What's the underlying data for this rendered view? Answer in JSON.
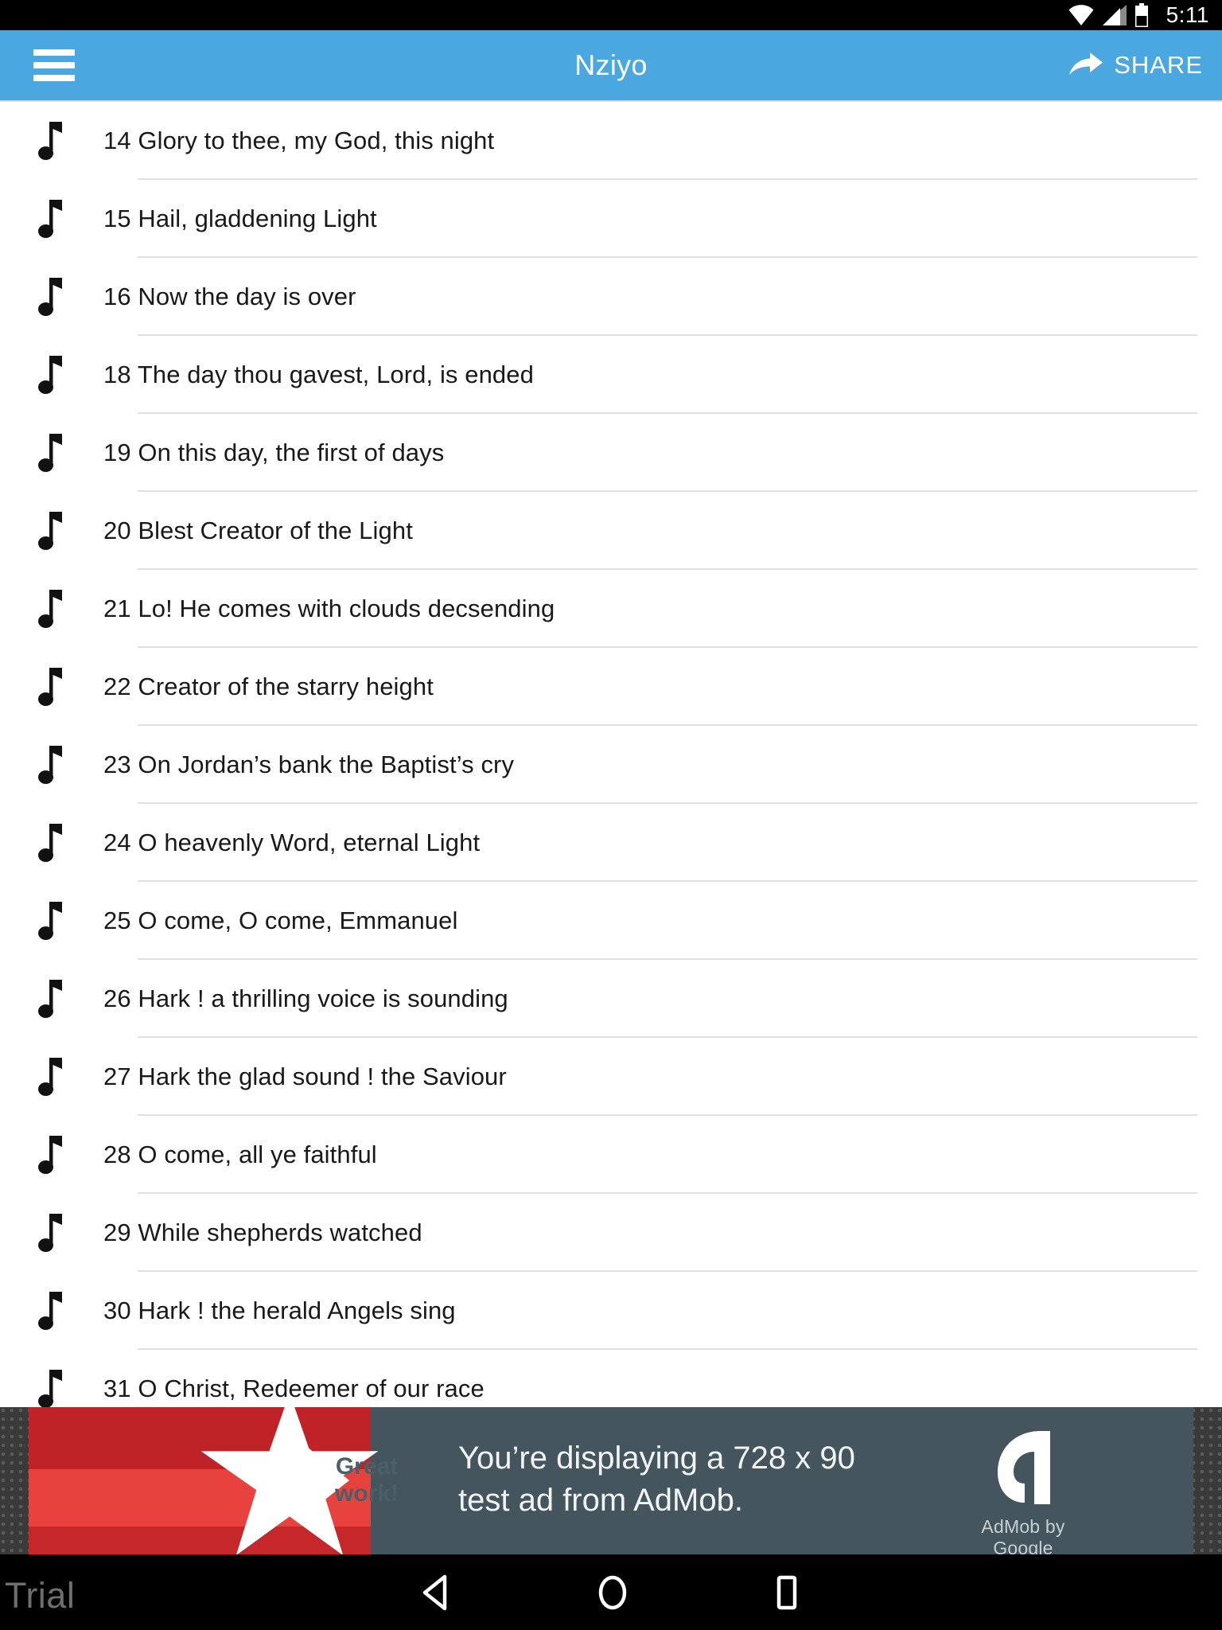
{
  "status_bar": {
    "time": "5:11",
    "icons": [
      "wifi-icon",
      "cell-signal-icon",
      "battery-icon"
    ]
  },
  "app_bar": {
    "menu_icon": "hamburger-menu-icon",
    "title": "Nziyo",
    "share_label": "SHARE",
    "share_icon": "share-arrow-icon",
    "background_color": "#4aa7e0"
  },
  "list": {
    "item_icon": "music-note-icon",
    "items": [
      {
        "label": "14 Glory to thee, my God, this night"
      },
      {
        "label": "15 Hail, gladdening Light"
      },
      {
        "label": "16 Now the day is over"
      },
      {
        "label": "18 The day thou gavest, Lord, is ended"
      },
      {
        "label": "19 On this day, the first of days"
      },
      {
        "label": "20 Blest Creator of the Light"
      },
      {
        "label": "21 Lo! He comes with clouds decsending"
      },
      {
        "label": "22 Creator of the starry height"
      },
      {
        "label": "23 On Jordan’s bank the Baptist’s cry"
      },
      {
        "label": "24 O heavenly Word, eternal Light"
      },
      {
        "label": "25 O come, O come, Emmanuel"
      },
      {
        "label": "26 Hark ! a thrilling voice is sounding"
      },
      {
        "label": "27 Hark the glad sound ! the Saviour"
      },
      {
        "label": "28 O come, all ye faithful"
      },
      {
        "label": "29 While shepherds watched"
      },
      {
        "label": "30 Hark ! the herald Angels sing"
      },
      {
        "label": "31 O Christ, Redeemer of our race"
      }
    ]
  },
  "ad": {
    "badge_line1": "Great",
    "badge_line2": "work!",
    "message_line1": "You’re displaying a 728 x 90",
    "message_line2": "test ad from AdMob.",
    "brand": "AdMob by Google",
    "logo_icon": "admob-logo-icon",
    "red_color": "#c12026",
    "panel_color": "#44555e"
  },
  "nav_bar": {
    "watermark": "Trial",
    "buttons": [
      {
        "name": "back-button"
      },
      {
        "name": "home-button"
      },
      {
        "name": "recents-button"
      }
    ]
  }
}
